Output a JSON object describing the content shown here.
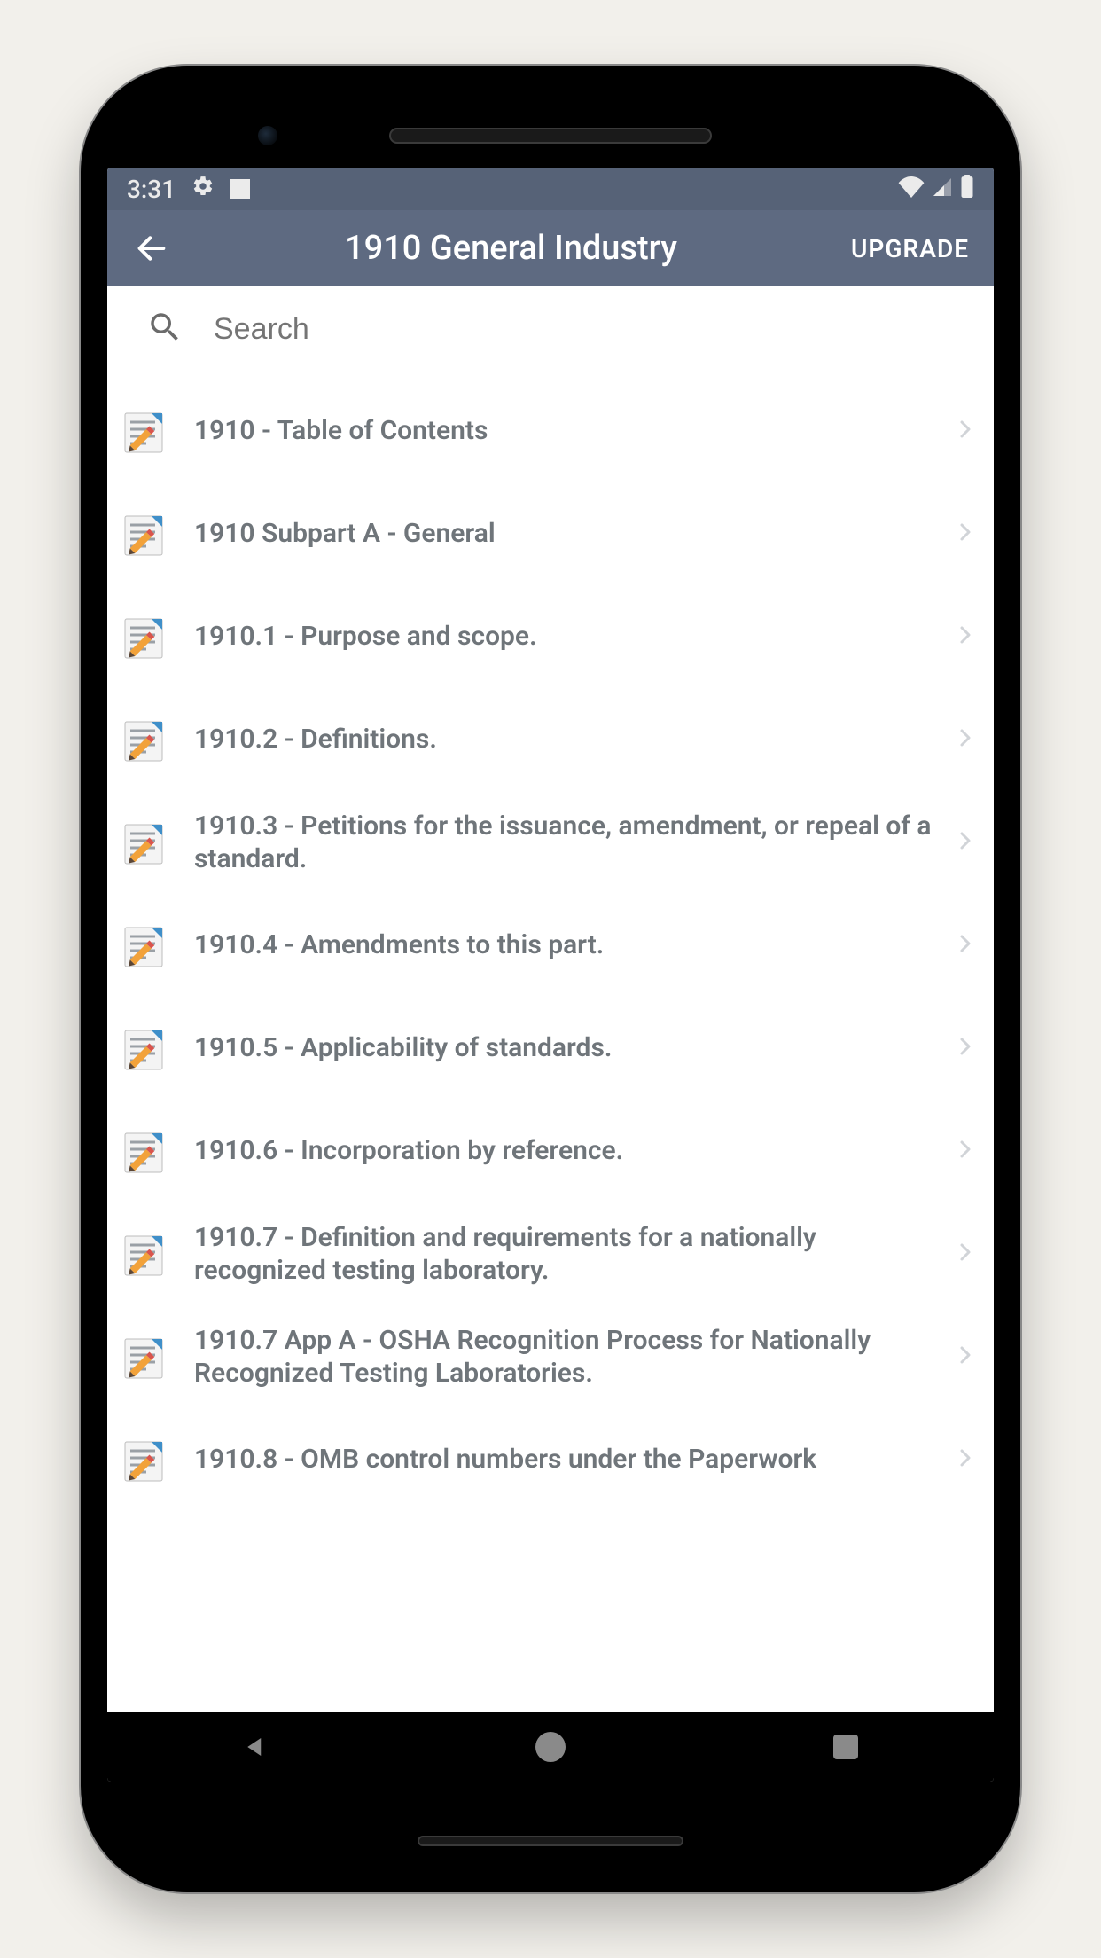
{
  "status": {
    "time": "3:31"
  },
  "appbar": {
    "title": "1910 General Industry",
    "upgrade": "UPGRADE"
  },
  "search": {
    "placeholder": "Search"
  },
  "list": {
    "items": [
      {
        "label": "1910 - Table of Contents"
      },
      {
        "label": "1910 Subpart A - General"
      },
      {
        "label": "1910.1 - Purpose and scope."
      },
      {
        "label": "1910.2 - Definitions."
      },
      {
        "label": "1910.3 - Petitions for the issuance, amendment, or repeal of a standard."
      },
      {
        "label": "1910.4 - Amendments to this part."
      },
      {
        "label": "1910.5 - Applicability of standards."
      },
      {
        "label": "1910.6 - Incorporation by reference."
      },
      {
        "label": "1910.7 - Definition and requirements for a nationally recognized testing laboratory."
      },
      {
        "label": "1910.7 App A - OSHA Recognition Process for Nationally Recognized Testing Laboratories."
      },
      {
        "label": "1910.8 - OMB control numbers under the Paperwork"
      }
    ]
  }
}
